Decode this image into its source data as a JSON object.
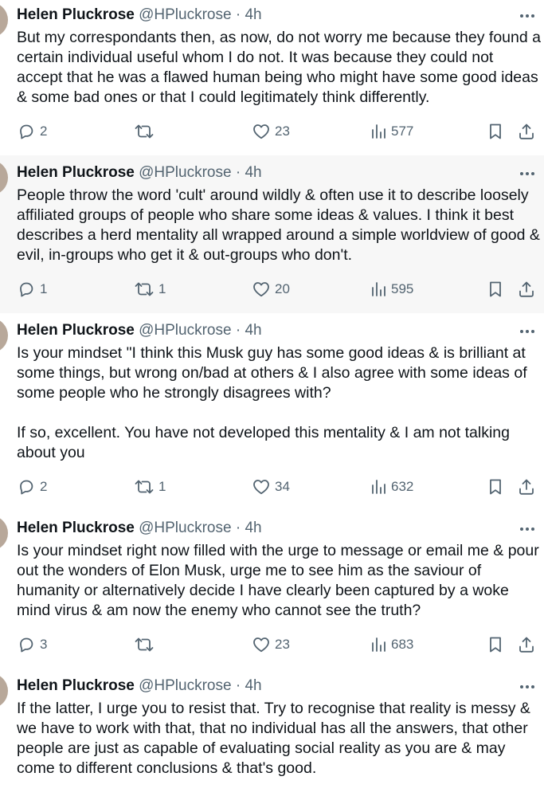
{
  "colors": {
    "text": "#0f1419",
    "muted": "#536471",
    "highlight_background": "#f7f7f7"
  },
  "tweets": [
    {
      "name": "Helen Pluckrose",
      "handle": "@HPluckrose",
      "separator": "·",
      "time": "4h",
      "text": "But my correspondants then, as now, do not worry me because they found a certain individual useful whom I do not. It was because they could not accept that he was a flawed human being who might have some good ideas & some bad ones or that I could legitimately think differently.",
      "replies": "2",
      "reposts": "",
      "likes": "23",
      "views": "577",
      "highlighted": false
    },
    {
      "name": "Helen Pluckrose",
      "handle": "@HPluckrose",
      "separator": "·",
      "time": "4h",
      "text": "People throw the word 'cult' around wildly & often use it to describe loosely affiliated groups of people who share some ideas & values. I think it best describes a herd mentality all wrapped around a simple worldview of good & evil, in-groups who get it & out-groups who don't.",
      "replies": "1",
      "reposts": "1",
      "likes": "20",
      "views": "595",
      "highlighted": true
    },
    {
      "name": "Helen Pluckrose",
      "handle": "@HPluckrose",
      "separator": "·",
      "time": "4h",
      "text": "Is your mindset \"I think this Musk guy has some good ideas & is brilliant at some things, but wrong on/bad at others & I also agree with some ideas of some people who he strongly disagrees with?\n\nIf so, excellent. You have not developed this mentality & I am not talking about you",
      "replies": "2",
      "reposts": "1",
      "likes": "34",
      "views": "632",
      "highlighted": false
    },
    {
      "name": "Helen Pluckrose",
      "handle": "@HPluckrose",
      "separator": "·",
      "time": "4h",
      "text": "Is your mindset right now filled with the urge to message or email me & pour out the wonders of Elon Musk, urge me to see him as the saviour of humanity or alternatively decide I have clearly been captured by a woke mind virus & am now the enemy who cannot see the truth?",
      "replies": "3",
      "reposts": "",
      "likes": "23",
      "views": "683",
      "highlighted": false
    },
    {
      "name": "Helen Pluckrose",
      "handle": "@HPluckrose",
      "separator": "·",
      "time": "4h",
      "text": "If the latter, I urge you to resist that. Try to recognise that reality is messy & we have to work with that, that no individual has all the answers, that other people are just as capable of evaluating social reality as you are & may come to different conclusions & that's good.",
      "replies": "",
      "reposts": "",
      "likes": "",
      "views": "",
      "highlighted": false
    }
  ]
}
